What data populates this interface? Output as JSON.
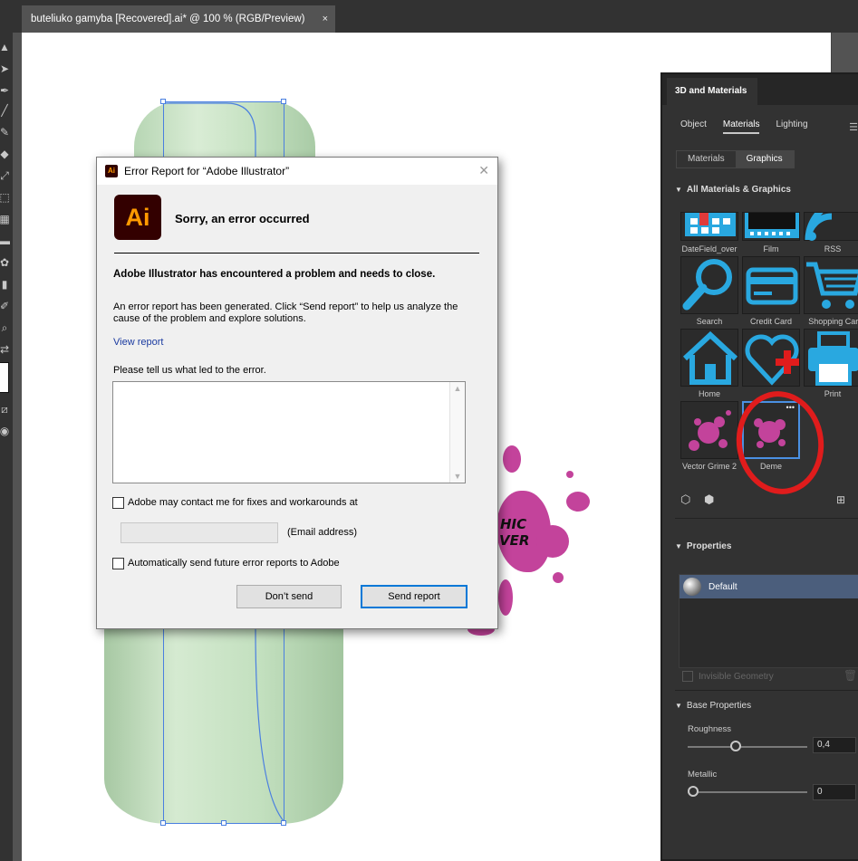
{
  "document": {
    "tab_title": "buteliuko gamyba [Recovered].ai* @ 100 % (RGB/Preview)",
    "tab_close": "×"
  },
  "splash_text": {
    "line1": "HIC",
    "line2": "VER"
  },
  "panel": {
    "title": "3D and Materials",
    "tabs": [
      "Object",
      "Materials",
      "Lighting"
    ],
    "active_tab": "Materials",
    "segments": [
      "Materials",
      "Graphics"
    ],
    "active_segment": "Graphics",
    "library_header": "All Materials & Graphics",
    "tiles": [
      {
        "label": "DateField_over",
        "icon": "datefield-icon"
      },
      {
        "label": "Film",
        "icon": "film-icon"
      },
      {
        "label": "RSS",
        "icon": "rss-icon"
      },
      {
        "label": "Search",
        "icon": "search-icon"
      },
      {
        "label": "Credit Card",
        "icon": "credit-card-icon"
      },
      {
        "label": "Shopping Cart",
        "icon": "shopping-cart-icon"
      },
      {
        "label": "Home",
        "icon": "home-icon"
      },
      {
        "label": "",
        "icon": "heart-plus-icon"
      },
      {
        "label": "Print",
        "icon": "print-icon"
      },
      {
        "label": "Vector Grime 2",
        "icon": "grime-icon"
      },
      {
        "label": "Deme",
        "icon": "deme-graphic-icon"
      }
    ],
    "tile_more": "•••",
    "properties_header": "Properties",
    "default_material": "Default",
    "invisible_geometry": "Invisible Geometry",
    "base_properties_header": "Base Properties",
    "roughness_label": "Roughness",
    "roughness_value": "0,4",
    "roughness_level": 0.4,
    "metallic_label": "Metallic",
    "metallic_value": "0",
    "metallic_level": 0
  },
  "dialog": {
    "title": "Error Report for “Adobe Illustrator”",
    "app_icon": "Ai",
    "close": "✕",
    "logo": "Ai",
    "heading": "Sorry, an error occurred",
    "problem": "Adobe Illustrator has encountered a problem and needs to close.",
    "description_line1": "An error report has been generated. Click “Send report” to help us analyze the",
    "description_line2": "cause of the problem and explore solutions.",
    "view_report": "View report",
    "prompt": "Please tell us what led to the error.",
    "textarea_value": "",
    "contact_label": "Adobe may contact me for fixes and workarounds at",
    "email_value": "",
    "email_hint": "(Email address)",
    "auto_send_label": "Automatically send future error reports to Adobe",
    "dont_send": "Don’t send",
    "send_report": "Send report",
    "contact_checked": false,
    "auto_send_checked": false
  },
  "colors": {
    "annotation": "#e01c1c",
    "icon_blue": "#29a8e0",
    "splash": "#c3439b",
    "ai_orange": "#ff9a00"
  }
}
